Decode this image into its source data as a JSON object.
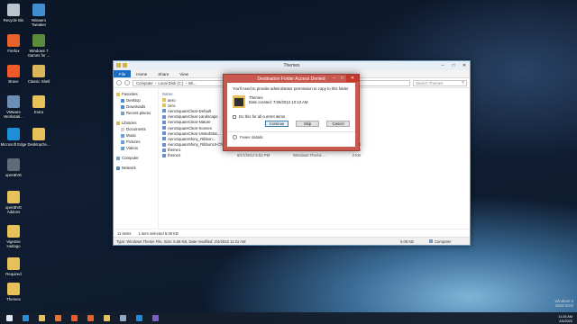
{
  "desktop": {
    "icons": [
      {
        "label": "Recycle Bin",
        "color": "#b9c4cc"
      },
      {
        "label": "Winaero Tweaker",
        "color": "#3f8fd2"
      },
      {
        "label": "Firefox",
        "color": "#e7622a"
      },
      {
        "label": "Windows 7 Games for ...",
        "color": "#5a8a3c"
      },
      {
        "label": "Brave",
        "color": "#f05a28"
      },
      {
        "label": "Classic Shell",
        "color": "#d9b75a"
      },
      {
        "label": "VMware Workstati...",
        "color": "#6d8fb3"
      },
      {
        "label": "Extra",
        "color": "#e6c15a"
      },
      {
        "label": "Microsoft Edge",
        "color": "#1c8fd8"
      },
      {
        "label": "DesktopGe...",
        "color": "#e6c15a"
      },
      {
        "label": "openBVE",
        "color": "#5f6c78"
      },
      {
        "label": "openBVE Addons",
        "color": "#e6c15a"
      },
      {
        "label": "Vigetnie Harlago",
        "color": "#e6c15a"
      },
      {
        "label": "Required",
        "color": "#e6c15a"
      },
      {
        "label": "Themes",
        "color": "#e6c15a"
      }
    ]
  },
  "explorer": {
    "title": "Themes",
    "tabs": [
      "File",
      "Home",
      "Share",
      "View"
    ],
    "address": [
      "Computer",
      "Local Disk (C:)",
      "Wi..."
    ],
    "search_placeholder": "Search Themes",
    "nav": {
      "favorites": "Favorites",
      "desktop": "Desktop",
      "downloads": "Downloads",
      "recent": "Recent places",
      "libraries": "Libraries",
      "documents": "Documents",
      "music": "Music",
      "pictures": "Pictures",
      "videos": "Videos",
      "computer": "Computer",
      "network": "Network"
    },
    "column_name": "Name",
    "files": [
      {
        "name": "aero",
        "date": "",
        "type": "",
        "size": "",
        "kind": "folder"
      },
      {
        "name": "zero",
        "date": "",
        "type": "",
        "size": "",
        "kind": "folder"
      },
      {
        "name": "AeroSquareClear-Default",
        "date": "",
        "type": "",
        "size": "",
        "kind": "theme"
      },
      {
        "name": "AeroSquareClear-Landscape",
        "date": "",
        "type": "",
        "size": "",
        "kind": "theme"
      },
      {
        "name": "AeroSquareClear-Nature",
        "date": "",
        "type": "",
        "size": "",
        "kind": "theme"
      },
      {
        "name": "AeroSquareClear-Scenes",
        "date": "",
        "type": "",
        "size": "",
        "kind": "theme"
      },
      {
        "name": "AeroSquareClear-UnitedStat...",
        "date": "",
        "type": "",
        "size": "",
        "kind": "theme"
      },
      {
        "name": "AeroSquareShiny_Ribbon...",
        "date": "",
        "type": "",
        "size": "",
        "kind": "theme"
      },
      {
        "name": "AeroSquareShiny_RibbonUI-Characters",
        "date": "2/4/2022 11:21 AM",
        "type": "Windows Theme ...",
        "size": "5 KB",
        "kind": "theme"
      },
      {
        "name": "theme1",
        "date": "8/17/2012 5:52 PM",
        "type": "Windows Theme ...",
        "size": "3 KB",
        "kind": "theme"
      },
      {
        "name": "theme2",
        "date": "8/17/2012 5:52 PM",
        "type": "Windows Theme ...",
        "size": "3 KB",
        "kind": "theme"
      }
    ],
    "status": {
      "items": "11 items",
      "selected": "1 item selected  5.08 KB"
    },
    "details": {
      "text": "Type: Windows Theme File, Size: 5.08 KB, Date modified: 2/4/2022 11:21 AM",
      "size": "5.08 KB",
      "location": "Computer"
    }
  },
  "dialog": {
    "title": "Destination Folder Access Denied",
    "message": "You'll need to provide administrator permission to copy to this folder",
    "item_name": "Themes",
    "item_date": "Date created: 7/26/2012 10:13 AM",
    "checkbox_label": "Do this for all current items",
    "continue_label": "Continue",
    "skip_label": "Skip",
    "cancel_label": "Cancel",
    "more_details": "Fewer details"
  },
  "taskbar": {
    "apps": [
      {
        "name": "start",
        "color": "#dfe8f2"
      },
      {
        "name": "ie",
        "color": "#2a8fd8"
      },
      {
        "name": "explorer",
        "color": "#e6c15a"
      },
      {
        "name": "media",
        "color": "#e8732e"
      },
      {
        "name": "brave",
        "color": "#f05a28"
      },
      {
        "name": "firefox",
        "color": "#e7622a"
      },
      {
        "name": "folder",
        "color": "#e6c15a"
      },
      {
        "name": "vm",
        "color": "#8fa9c4"
      },
      {
        "name": "edge",
        "color": "#1c8fd8"
      },
      {
        "name": "vs",
        "color": "#7b5fc2"
      }
    ],
    "time": "11:26 AM",
    "date": "2/4/2022"
  },
  "watermark": {
    "line1": "Windows 8",
    "line2": "Build 9200"
  }
}
